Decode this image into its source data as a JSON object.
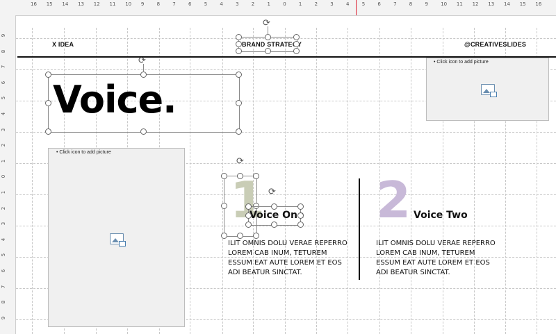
{
  "ruler": {
    "top_numbers": [
      "16",
      "15",
      "14",
      "13",
      "12",
      "11",
      "10",
      "9",
      "8",
      "7",
      "6",
      "5",
      "4",
      "3",
      "2",
      "1",
      "0",
      "1",
      "2",
      "3",
      "4",
      "5",
      "6",
      "7",
      "8",
      "9",
      "10",
      "11",
      "12",
      "13",
      "14",
      "15",
      "16"
    ],
    "left_numbers": [
      "9",
      "8",
      "7",
      "6",
      "5",
      "4",
      "3",
      "2",
      "1",
      "0",
      "1",
      "2",
      "3",
      "4",
      "5",
      "6",
      "7",
      "8",
      "9"
    ]
  },
  "header": {
    "left": "X IDEA",
    "center": "BRAND STRATEGY",
    "right": "@CREATIVESLIDES"
  },
  "title": "Voice.",
  "placeholders": {
    "top_right_label": "Click icon to add picture",
    "left_label": "Click icon to add picture"
  },
  "voice_one": {
    "number": "1",
    "title": "Voice One",
    "body": "ILIT OMNIS DOLU VERAE REPERRO LOREM CAB INUM, TETUREM ESSUM EAT AUTE LOREM ET EOS ADI BEATUR SINCTAT."
  },
  "voice_two": {
    "number": "2",
    "title": "Voice Two",
    "body": "ILIT OMNIS DOLU VERAE REPERRO LOREM CAB INUM, TETUREM ESSUM EAT AUTE LOREM ET EOS ADI BEATUR SINCTAT."
  },
  "colors": {
    "voice_one_number": "#c9cdb6",
    "voice_two_number": "#c8b9d8",
    "placeholder_bg": "#f0f0f0"
  }
}
